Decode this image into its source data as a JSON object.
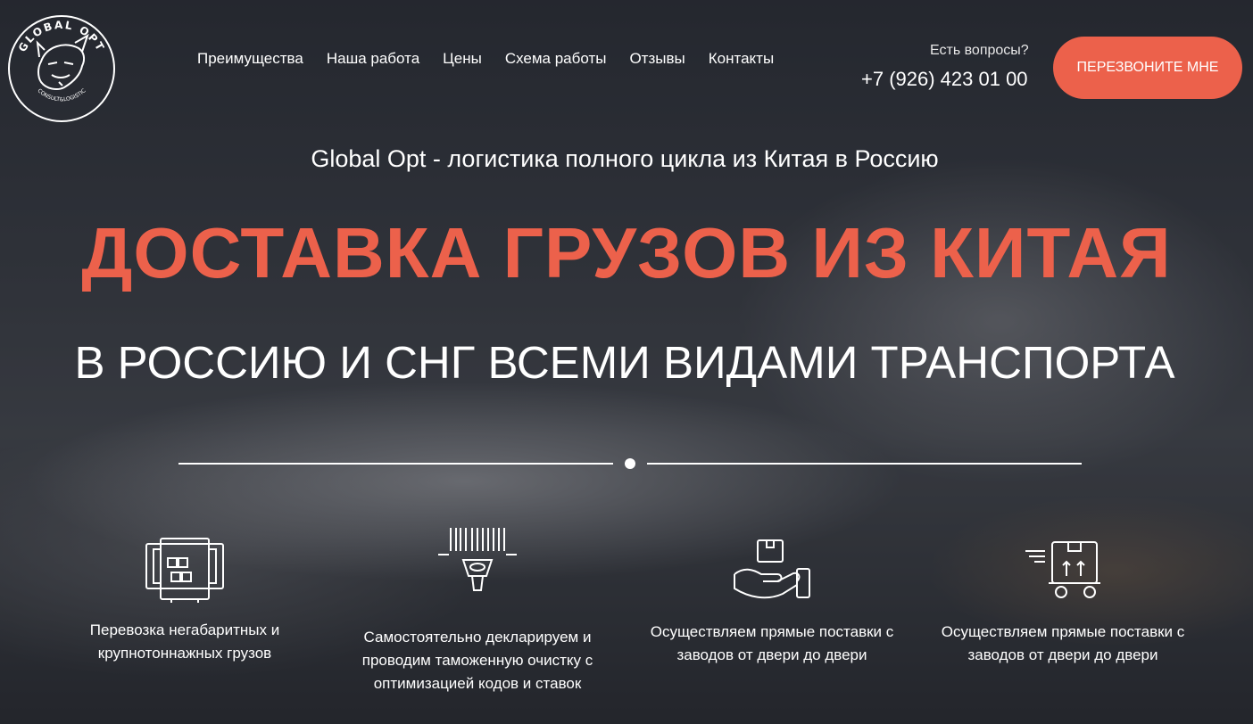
{
  "logo": {
    "top_text": "GLOBAL OPT",
    "bottom_text": "CONSULT&LOGISTIC"
  },
  "nav": [
    "Преимущества",
    "Наша работа",
    "Цены",
    "Схема работы",
    "Отзывы",
    "Контакты"
  ],
  "contact": {
    "question": "Есть вопросы?",
    "phone": "+7 (926) 423 01 00",
    "callback_label": "ПЕРЕЗВОНИТЕ МНЕ"
  },
  "hero": {
    "subtitle": "Global Opt - логистика полного цикла из Китая в Россию",
    "headline": "ДОСТАВКА ГРУЗОВ ИЗ КИТАЯ",
    "headline2": "В РОССИЮ И СНГ ВСЕМИ ВИДАМИ ТРАНСПОРТА"
  },
  "features": [
    {
      "icon": "container-icon",
      "text": "Перевозка негабаритных и крупнотоннажных грузов"
    },
    {
      "icon": "barcode-scanner-icon",
      "text": "Самостоятельно декларируем и проводим таможенную очистку с оптимизацией кодов и ставок"
    },
    {
      "icon": "hand-box-icon",
      "text": "Осуществляем прямые поставки с заводов от двери до двери"
    },
    {
      "icon": "delivery-cart-icon",
      "text": "Осуществляем прямые поставки с заводов от двери до двери"
    }
  ],
  "colors": {
    "accent": "#ec614b",
    "text": "#ffffff"
  }
}
